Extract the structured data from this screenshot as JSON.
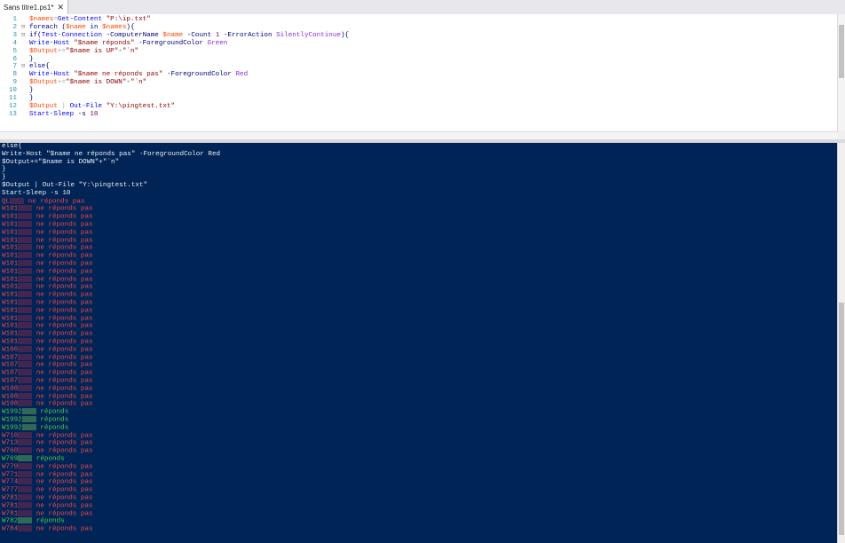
{
  "tab": {
    "title": "Sans titre1.ps1*",
    "close": "✕"
  },
  "editor": {
    "lines": [
      {
        "n": "1",
        "fold": "",
        "tokens": [
          [
            "var",
            "$names"
          ],
          [
            "op",
            "="
          ],
          [
            "cmd",
            "Get-Content"
          ],
          [
            "txt",
            " "
          ],
          [
            "str",
            "\"P:\\ip.txt\""
          ]
        ]
      },
      {
        "n": "2",
        "fold": "⊟",
        "tokens": [
          [
            "kw",
            "foreach"
          ],
          [
            "txt",
            " "
          ],
          [
            "par",
            "("
          ],
          [
            "var",
            "$name"
          ],
          [
            "txt",
            " "
          ],
          [
            "kw",
            "in"
          ],
          [
            "txt",
            " "
          ],
          [
            "var",
            "$names"
          ],
          [
            "par",
            ")"
          ],
          [
            "par",
            "{"
          ]
        ]
      },
      {
        "n": "3",
        "fold": "⊟",
        "tokens": [
          [
            "kw",
            "if"
          ],
          [
            "par",
            "("
          ],
          [
            "cmd",
            "Test-Connection"
          ],
          [
            "txt",
            " "
          ],
          [
            "par",
            "-ComputerName"
          ],
          [
            "txt",
            " "
          ],
          [
            "var",
            "$name"
          ],
          [
            "txt",
            " "
          ],
          [
            "par",
            "-Count"
          ],
          [
            "txt",
            " "
          ],
          [
            "num",
            "1"
          ],
          [
            "txt",
            " "
          ],
          [
            "par",
            "-ErrorAction"
          ],
          [
            "txt",
            " "
          ],
          [
            "arg",
            "SilentlyContinue"
          ],
          [
            "par",
            ")"
          ],
          [
            "par",
            "{"
          ]
        ]
      },
      {
        "n": "4",
        "fold": "",
        "tokens": [
          [
            "cmd",
            "Write-Host"
          ],
          [
            "txt",
            " "
          ],
          [
            "str",
            "\"$name réponds\""
          ],
          [
            "txt",
            " "
          ],
          [
            "par",
            "-ForegroundColor"
          ],
          [
            "txt",
            " "
          ],
          [
            "arg",
            "Green"
          ]
        ]
      },
      {
        "n": "5",
        "fold": "",
        "tokens": [
          [
            "var",
            "$Output"
          ],
          [
            "op",
            "+="
          ],
          [
            "str",
            "\"$name is UP\""
          ],
          [
            "op",
            "+"
          ],
          [
            "str",
            "\"`n\""
          ]
        ]
      },
      {
        "n": "6",
        "fold": "",
        "tokens": [
          [
            "par",
            "}"
          ]
        ]
      },
      {
        "n": "7",
        "fold": "⊟",
        "tokens": [
          [
            "kw",
            "else"
          ],
          [
            "par",
            "{"
          ]
        ]
      },
      {
        "n": "8",
        "fold": "",
        "tokens": [
          [
            "cmd",
            "Write-Host"
          ],
          [
            "txt",
            " "
          ],
          [
            "str",
            "\"$name ne réponds pas\""
          ],
          [
            "txt",
            " "
          ],
          [
            "par",
            "-ForegroundColor"
          ],
          [
            "txt",
            " "
          ],
          [
            "arg",
            "Red"
          ]
        ]
      },
      {
        "n": "9",
        "fold": "",
        "tokens": [
          [
            "var",
            "$Output"
          ],
          [
            "op",
            "+="
          ],
          [
            "str",
            "\"$name is DOWN\""
          ],
          [
            "op",
            "+"
          ],
          [
            "str",
            "\"`n\""
          ]
        ]
      },
      {
        "n": "10",
        "fold": "",
        "tokens": [
          [
            "par",
            "}"
          ]
        ]
      },
      {
        "n": "11",
        "fold": "",
        "tokens": [
          [
            "par",
            "}"
          ]
        ]
      },
      {
        "n": "12",
        "fold": "",
        "tokens": [
          [
            "var",
            "$Output"
          ],
          [
            "txt",
            " "
          ],
          [
            "op",
            "|"
          ],
          [
            "txt",
            " "
          ],
          [
            "cmd",
            "Out-File"
          ],
          [
            "txt",
            " "
          ],
          [
            "str",
            "\"Y:\\pingtest.txt\""
          ]
        ]
      },
      {
        "n": "13",
        "fold": "",
        "tokens": [
          [
            "cmd",
            "Start-Sleep"
          ],
          [
            "txt",
            " "
          ],
          [
            "par",
            "-s"
          ],
          [
            "txt",
            " "
          ],
          [
            "num",
            "10"
          ]
        ]
      }
    ]
  },
  "console": {
    "echo": [
      "else{",
      "Write-Host \"$name ne réponds pas\" -ForegroundColor Red",
      "$Output+=\"$name is DOWN\"+\"`n\"",
      "}",
      "}",
      "$Output | Out-File \"Y:\\pingtest.txt\"",
      "Start-Sleep -s 10"
    ],
    "results": [
      {
        "prefix": "QL",
        "status": "ko",
        "msg": "ne réponds pas"
      },
      {
        "prefix": "W101",
        "status": "ko",
        "msg": "ne réponds pas"
      },
      {
        "prefix": "W101",
        "status": "ko",
        "msg": "ne réponds pas"
      },
      {
        "prefix": "W101",
        "status": "ko",
        "msg": "ne réponds pas"
      },
      {
        "prefix": "W101",
        "status": "ko",
        "msg": "ne réponds pas"
      },
      {
        "prefix": "W101",
        "status": "ko",
        "msg": "ne réponds pas"
      },
      {
        "prefix": "W101",
        "status": "ko",
        "msg": "ne réponds pas"
      },
      {
        "prefix": "W101",
        "status": "ko",
        "msg": "ne réponds pas"
      },
      {
        "prefix": "W101",
        "status": "ko",
        "msg": "ne réponds pas"
      },
      {
        "prefix": "W101",
        "status": "ko",
        "msg": "ne réponds pas"
      },
      {
        "prefix": "W101",
        "status": "ko",
        "msg": "ne réponds pas"
      },
      {
        "prefix": "W101",
        "status": "ko",
        "msg": "ne réponds pas"
      },
      {
        "prefix": "W101",
        "status": "ko",
        "msg": "ne réponds pas"
      },
      {
        "prefix": "W101",
        "status": "ko",
        "msg": "ne réponds pas"
      },
      {
        "prefix": "W101",
        "status": "ko",
        "msg": "ne réponds pas"
      },
      {
        "prefix": "W101",
        "status": "ko",
        "msg": "ne réponds pas"
      },
      {
        "prefix": "W101",
        "status": "ko",
        "msg": "ne réponds pas"
      },
      {
        "prefix": "W101",
        "status": "ko",
        "msg": "ne réponds pas"
      },
      {
        "prefix": "W101",
        "status": "ko",
        "msg": "ne réponds pas"
      },
      {
        "prefix": "W106",
        "status": "ko",
        "msg": "ne réponds pas"
      },
      {
        "prefix": "W107",
        "status": "ko",
        "msg": "ne réponds pas"
      },
      {
        "prefix": "W107",
        "status": "ko",
        "msg": "ne réponds pas"
      },
      {
        "prefix": "W107",
        "status": "ko",
        "msg": "ne réponds pas"
      },
      {
        "prefix": "W107",
        "status": "ko",
        "msg": "ne réponds pas"
      },
      {
        "prefix": "W108",
        "status": "ko",
        "msg": "ne réponds pas"
      },
      {
        "prefix": "W108",
        "status": "ko",
        "msg": "ne réponds pas"
      },
      {
        "prefix": "W108",
        "status": "ko",
        "msg": "ne réponds pas"
      },
      {
        "prefix": "W1092",
        "status": "ok",
        "msg": "réponds"
      },
      {
        "prefix": "W1092",
        "status": "ok",
        "msg": "réponds"
      },
      {
        "prefix": "W1092",
        "status": "ok",
        "msg": "réponds"
      },
      {
        "prefix": "W710",
        "status": "ko",
        "msg": "ne réponds pas"
      },
      {
        "prefix": "W713",
        "status": "ko",
        "msg": "ne réponds pas"
      },
      {
        "prefix": "W760",
        "status": "ko",
        "msg": "ne réponds pas"
      },
      {
        "prefix": "W769",
        "status": "ok",
        "msg": "réponds"
      },
      {
        "prefix": "W770",
        "status": "ko",
        "msg": "ne réponds pas"
      },
      {
        "prefix": "W771",
        "status": "ko",
        "msg": "ne réponds pas"
      },
      {
        "prefix": "W774",
        "status": "ko",
        "msg": "ne réponds pas"
      },
      {
        "prefix": "W777",
        "status": "ko",
        "msg": "ne réponds pas"
      },
      {
        "prefix": "W781",
        "status": "ko",
        "msg": "ne réponds pas"
      },
      {
        "prefix": "W781",
        "status": "ko",
        "msg": "ne réponds pas"
      },
      {
        "prefix": "W781",
        "status": "ko",
        "msg": "ne réponds pas"
      },
      {
        "prefix": "W782",
        "status": "ok",
        "msg": "réponds"
      },
      {
        "prefix": "W784",
        "status": "ko",
        "msg": "ne réponds pas"
      }
    ]
  },
  "colors": {
    "console_bg": "#012456",
    "ok": "#4ec94e",
    "ko": "#e8474c"
  }
}
